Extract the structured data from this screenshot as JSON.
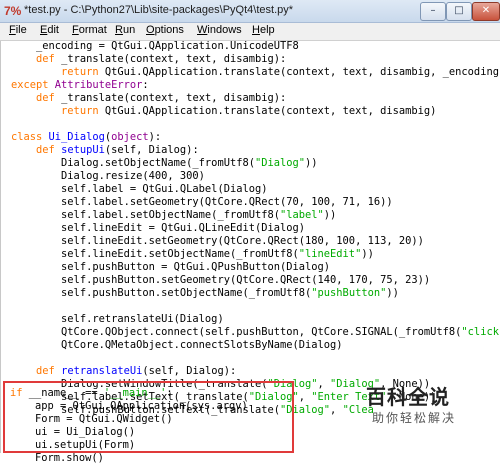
{
  "window": {
    "title": "*test.py - C:\\Python27\\Lib\\site-packages\\PyQt4\\test.py*",
    "app_icon": "7%",
    "controls": {
      "minimize": "–",
      "maximize": "□",
      "close": "✕"
    }
  },
  "menu": [
    {
      "first": "F",
      "rest": "ile"
    },
    {
      "first": "E",
      "rest": "dit"
    },
    {
      "first": "F",
      "rest": "ormat"
    },
    {
      "first": "R",
      "rest": "un"
    },
    {
      "first": "O",
      "rest": "ptions"
    },
    {
      "first": "W",
      "rest": "indows"
    },
    {
      "first": "H",
      "rest": "elp"
    }
  ],
  "code": {
    "l0": {
      "a": "    _encoding = QtGui.QApplication.UnicodeUTF8"
    },
    "l1": {
      "a": "    ",
      "b": "def",
      "c": " _translate(context, text, disambig):"
    },
    "l2": {
      "a": "        ",
      "b": "return",
      "c": " QtGui.QApplication.translate(context, text, disambig, _encoding)"
    },
    "l3": {
      "a": "except",
      "b": " AttributeError",
      "c": ":"
    },
    "l4": {
      "a": "    ",
      "b": "def",
      "c": " _translate(context, text, disambig):"
    },
    "l5": {
      "a": "        ",
      "b": "return",
      "c": " QtGui.QApplication.translate(context, text, disambig)"
    },
    "l6": {
      "a": ""
    },
    "l7": {
      "a": "class",
      "b": " Ui_Dialog",
      "c": "(",
      "d": "object",
      "e": "):"
    },
    "l8": {
      "a": "    ",
      "b": "def",
      "c": " setupUi",
      "d": "(self, Dialog):"
    },
    "l9": {
      "a": "        Dialog.setObjectName(_fromUtf8(",
      "b": "\"Dialog\"",
      "c": "))"
    },
    "l10": {
      "a": "        Dialog.resize(400, 300)"
    },
    "l11": {
      "a": "        self.label = QtGui.QLabel(Dialog)"
    },
    "l12": {
      "a": "        self.label.setGeometry(QtCore.QRect(70, 100, 71, 16))"
    },
    "l13": {
      "a": "        self.label.setObjectName(_fromUtf8(",
      "b": "\"label\"",
      "c": "))"
    },
    "l14": {
      "a": "        self.lineEdit = QtGui.QLineEdit(Dialog)"
    },
    "l15": {
      "a": "        self.lineEdit.setGeometry(QtCore.QRect(180, 100, 113, 20))"
    },
    "l16": {
      "a": "        self.lineEdit.setObjectName(_fromUtf8(",
      "b": "\"lineEdit\"",
      "c": "))"
    },
    "l17": {
      "a": "        self.pushButton = QtGui.QPushButton(Dialog)"
    },
    "l18": {
      "a": "        self.pushButton.setGeometry(QtCore.QRect(140, 170, 75, 23))"
    },
    "l19": {
      "a": "        self.pushButton.setObjectName(_fromUtf8(",
      "b": "\"pushButton\"",
      "c": "))"
    },
    "l20": {
      "a": ""
    },
    "l21": {
      "a": "        self.retranslateUi(Dialog)"
    },
    "l22": {
      "a": "        QtCore.QObject.connect(self.pushButton, QtCore.SIGNAL(_fromUtf8(",
      "b": "\"clicked"
    },
    "l23": {
      "a": "        QtCore.QMetaObject.connectSlotsByName(Dialog)"
    },
    "l24": {
      "a": ""
    },
    "l25": {
      "a": "    ",
      "b": "def",
      "c": " retranslateUi",
      "d": "(self, Dialog):"
    },
    "l26": {
      "a": "        Dialog.setWindowTitle(_translate(",
      "b": "\"Dialog\"",
      "c": ", ",
      "d": "\"Dialog\"",
      "e": ", None))"
    },
    "l27": {
      "a": "        self.label.setText(_translate(",
      "b": "\"Dialog\"",
      "c": ", ",
      "d": "\"Enter Text\"",
      "e": ", None))"
    },
    "l28": {
      "a": "        self.pushButton.setText(_translate(",
      "b": "\"Dialog\"",
      "c": ", ",
      "d": "\"Clea"
    },
    "l29": {
      "a": ""
    },
    "l30": {
      "a": "if",
      "b": " __name__ == ",
      "c": "'__main__'",
      "d": ":"
    },
    "l31": {
      "a": "    app = QtGui.QApplication(sys.argv)"
    },
    "l32": {
      "a": "    Form = QtGui.QWidget()"
    },
    "l33": {
      "a": "    ui = Ui_Dialog()"
    },
    "l34": {
      "a": "    ui.setupUi(Form)"
    },
    "l35": {
      "a": "    Form.show()"
    }
  },
  "watermark": {
    "title": "百科全说",
    "subtitle": "助你轻松解决"
  },
  "colors": {
    "keyword": "#ff7700",
    "builtin": "#900090",
    "string": "#00aa00",
    "definition": "#0000ff",
    "highlight_box": "#e03a3a"
  }
}
